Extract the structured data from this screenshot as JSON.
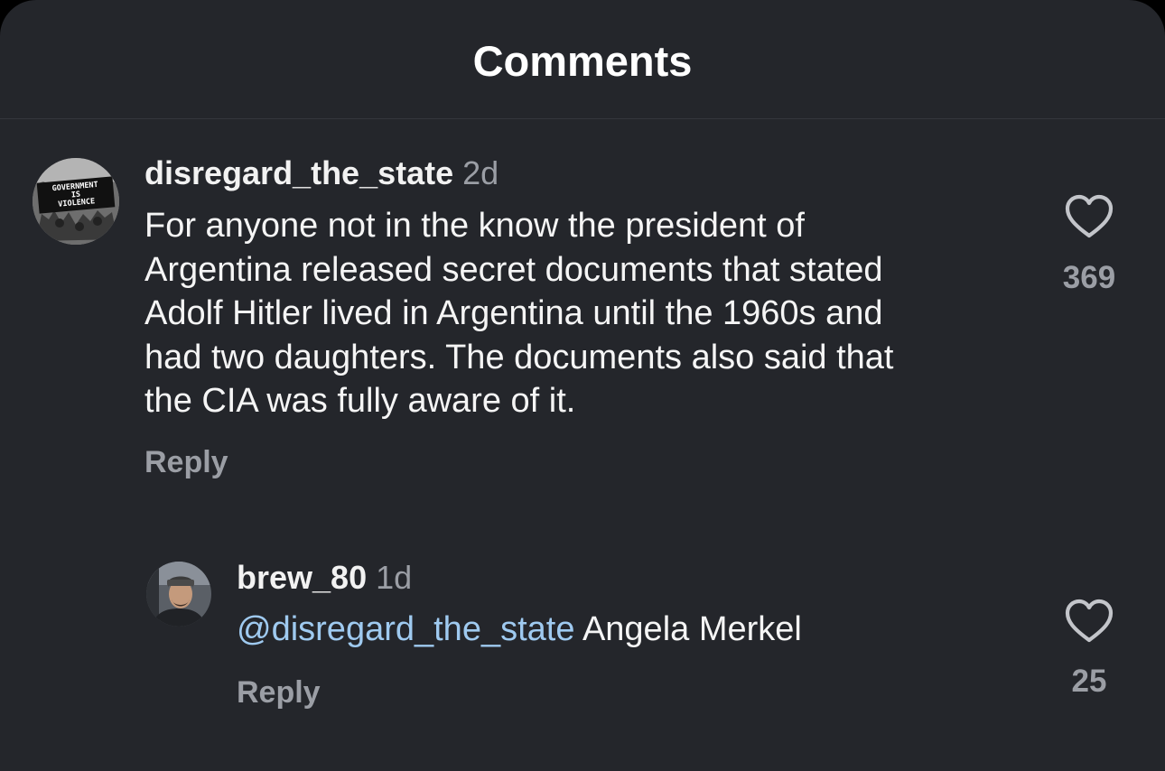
{
  "header": {
    "title": "Comments"
  },
  "comments": [
    {
      "username": "disregard_the_state",
      "time": "2d",
      "avatar_text": [
        "GOVERNMENT",
        "IS",
        "VIOLENCE"
      ],
      "text_lines": [
        "For anyone not in the know the president of",
        "Argentina released secret documents that stated",
        "Adolf Hitler lived in Argentina until the 1960s and",
        "had two daughters. The documents also said that",
        "the CIA was fully aware of it."
      ],
      "reply_label": "Reply",
      "like_icon": "heart-outline-icon",
      "likes": "369"
    }
  ],
  "replies": [
    {
      "username": "brew_80",
      "time": "1d",
      "mention": "@disregard_the_state",
      "text": " Angela Merkel",
      "reply_label": "Reply",
      "like_icon": "heart-outline-icon",
      "likes": "25"
    }
  ],
  "colors": {
    "background": "#24262b",
    "mention": "#9fcaf0",
    "secondary_text": "#9b9ea5"
  }
}
